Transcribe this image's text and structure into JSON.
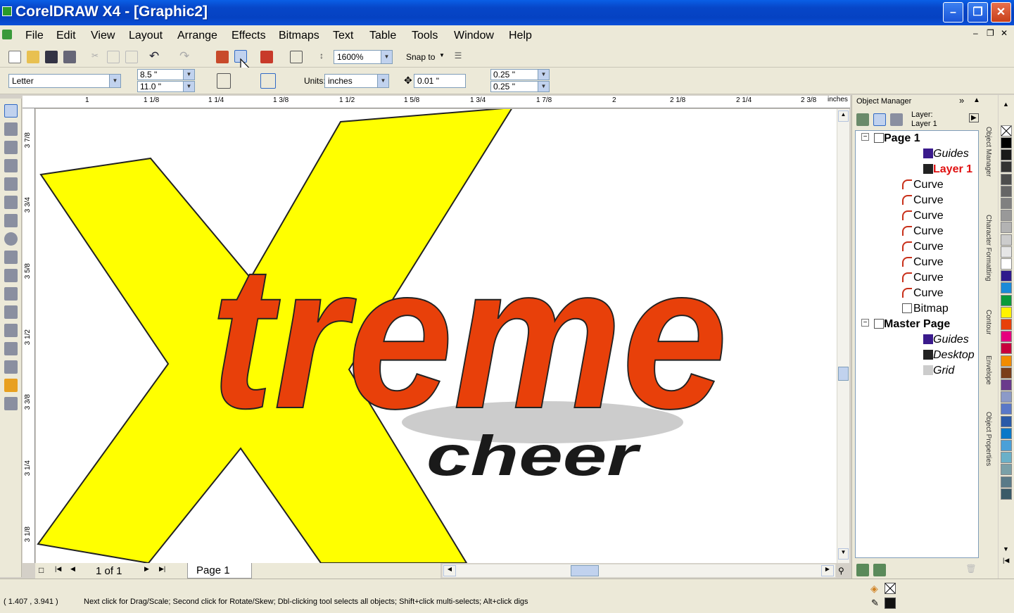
{
  "window": {
    "title": "CorelDRAW X4 - [Graphic2]",
    "minimize": "–",
    "restore": "❐",
    "close": "✕"
  },
  "menu": [
    "File",
    "Edit",
    "View",
    "Layout",
    "Arrange",
    "Effects",
    "Bitmaps",
    "Text",
    "Table",
    "Tools",
    "Window",
    "Help"
  ],
  "toolbar": {
    "zoom": "1600%",
    "snap": "Snap to"
  },
  "propertybar": {
    "paper": "Letter",
    "width": "8.5 \"",
    "height": "11.0 \"",
    "units_label": "Units:",
    "units": "inches",
    "nudge": "0.01 \"",
    "dup_x": "0.25 \"",
    "dup_y": "0.25 \""
  },
  "ruler": {
    "unit": "inches",
    "h_labels": [
      "1",
      "1 1/8",
      "1 1/4",
      "1 3/8",
      "1 1/2",
      "1 5/8",
      "1 3/4",
      "1 7/8",
      "2",
      "2 1/8",
      "2 1/4",
      "2 3/8"
    ],
    "v_labels": [
      "3 7/8",
      "3 3/4",
      "3 5/8",
      "3 1/2",
      "3 3/8",
      "3 1/4",
      "3 1/8"
    ]
  },
  "artwork": {
    "word1": "treme",
    "word2": "cheer",
    "x_color": "#ffff00",
    "text_color": "#e8400a"
  },
  "pagebar": {
    "counter": "1 of 1",
    "page_tab": "Page 1"
  },
  "status": {
    "coords": "( 1.407 , 3.941 )",
    "hint": "Next click for Drag/Scale; Second click for Rotate/Skew; Dbl-clicking tool selects all objects; Shift+click multi-selects; Alt+click digs"
  },
  "object_manager": {
    "title": "Object Manager",
    "layer_label": "Layer:",
    "layer_name": "Layer 1",
    "tree": [
      {
        "label": "Page 1",
        "bold": true
      },
      {
        "label": "Guides",
        "italic": true
      },
      {
        "label": "Layer 1",
        "bold": true,
        "red": true
      },
      {
        "label": "Curve"
      },
      {
        "label": "Curve"
      },
      {
        "label": "Curve"
      },
      {
        "label": "Curve"
      },
      {
        "label": "Curve"
      },
      {
        "label": "Curve"
      },
      {
        "label": "Curve"
      },
      {
        "label": "Curve"
      },
      {
        "label": "Bitmap"
      },
      {
        "label": "Master Page",
        "bold": true
      },
      {
        "label": "Guides",
        "italic": true
      },
      {
        "label": "Desktop",
        "italic": true
      },
      {
        "label": "Grid",
        "italic": true
      }
    ]
  },
  "docker_tabs": [
    "Object Manager",
    "Character Formatting",
    "Contour",
    "Envelope",
    "Object Properties"
  ],
  "palette": [
    "#000000",
    "#1a1a1a",
    "#333333",
    "#4d4d4d",
    "#666666",
    "#808080",
    "#999999",
    "#b3b3b3",
    "#cccccc",
    "#e6e6e6",
    "#ffffff",
    "#2e1a8c",
    "#1b8ad8",
    "#0a9a3a",
    "#fff200",
    "#e8400a",
    "#e6007e",
    "#c8003c",
    "#f28c00",
    "#7a3e1a",
    "#6a3a8c",
    "#8c9ac8",
    "#5a78c8",
    "#2a5aa8",
    "#0a78c8",
    "#4aa0d8",
    "#6ab0c8",
    "#7aa0a8",
    "#5a7a88",
    "#3a5a68"
  ]
}
